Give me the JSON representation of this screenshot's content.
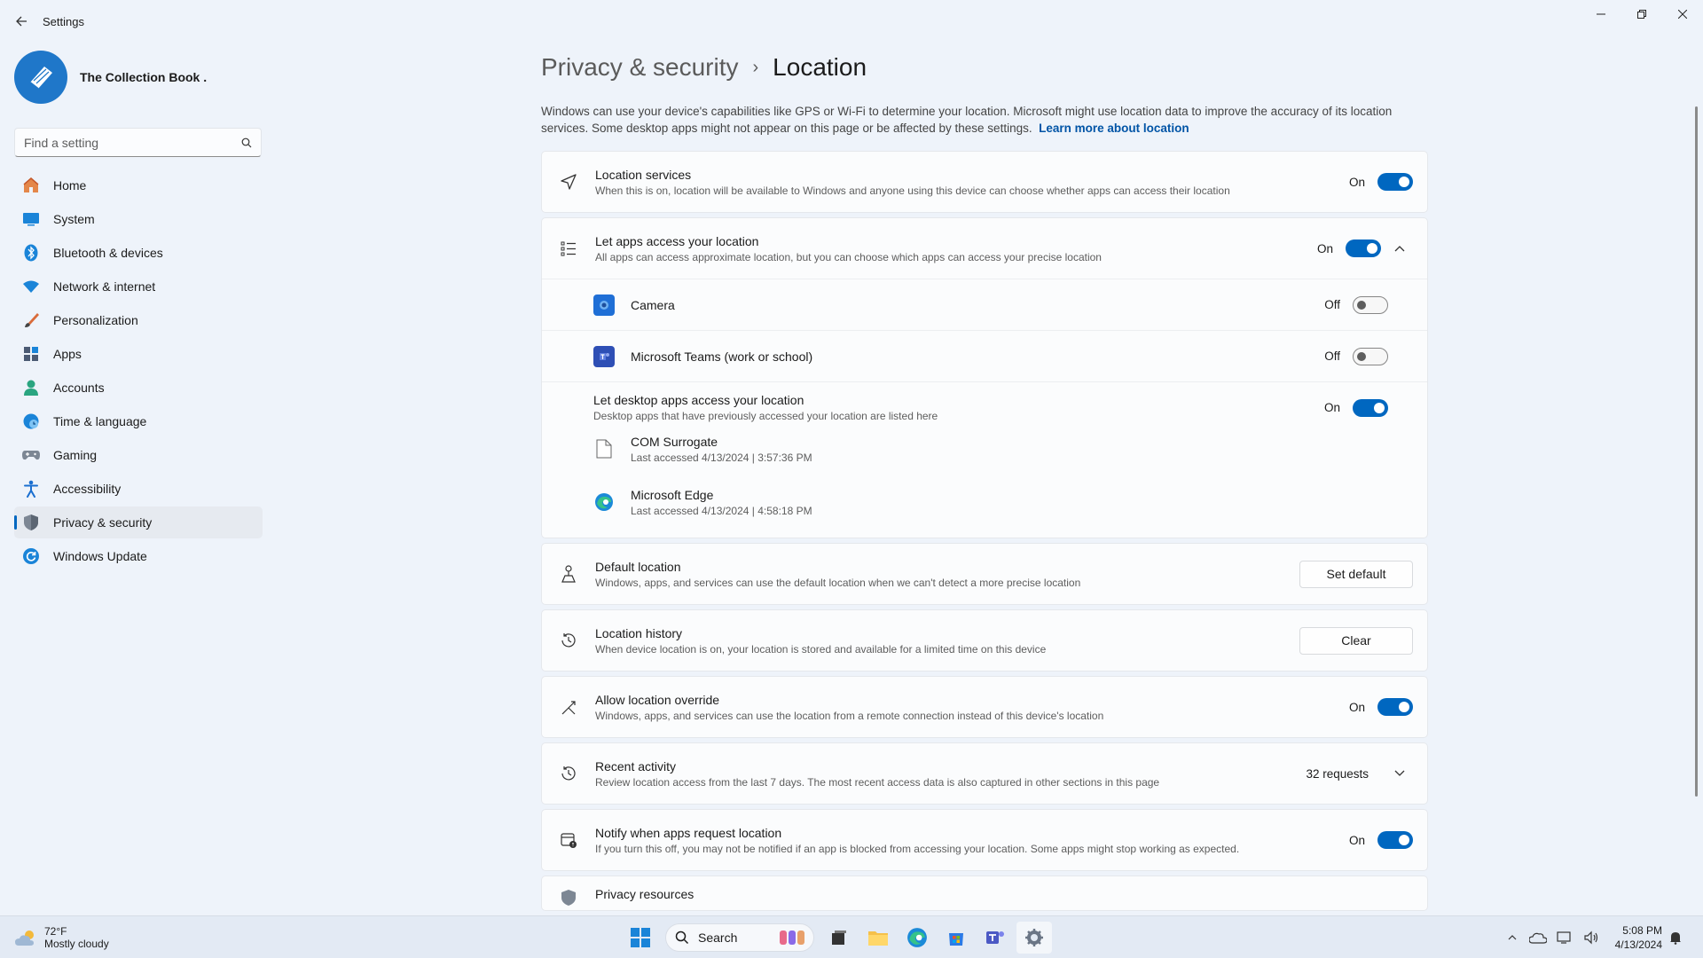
{
  "window": {
    "app_title": "Settings"
  },
  "profile": {
    "name": "The Collection Book ."
  },
  "search": {
    "placeholder": "Find a setting"
  },
  "sidebar": {
    "items": [
      {
        "label": "Home",
        "icon": "home-icon"
      },
      {
        "label": "System",
        "icon": "system-icon"
      },
      {
        "label": "Bluetooth & devices",
        "icon": "bluetooth-icon"
      },
      {
        "label": "Network & internet",
        "icon": "wifi-icon"
      },
      {
        "label": "Personalization",
        "icon": "brush-icon"
      },
      {
        "label": "Apps",
        "icon": "apps-icon"
      },
      {
        "label": "Accounts",
        "icon": "person-icon"
      },
      {
        "label": "Time & language",
        "icon": "globe-clock-icon"
      },
      {
        "label": "Gaming",
        "icon": "gamepad-icon"
      },
      {
        "label": "Accessibility",
        "icon": "accessibility-icon"
      },
      {
        "label": "Privacy & security",
        "icon": "shield-icon",
        "active": true
      },
      {
        "label": "Windows Update",
        "icon": "update-icon"
      }
    ]
  },
  "header": {
    "parent": "Privacy & security",
    "separator": "›",
    "current": "Location"
  },
  "intro": {
    "text": "Windows can use your device's capabilities like GPS or Wi-Fi to determine your location. Microsoft might use location data to improve the accuracy of its location services. Some desktop apps might not appear on this page or be affected by these settings.",
    "link": "Learn more about location"
  },
  "location_services": {
    "title": "Location services",
    "sub": "When this is on, location will be available to Windows and anyone using this device can choose whether apps can access their location",
    "state": "On"
  },
  "app_access": {
    "title": "Let apps access your location",
    "sub": "All apps can access approximate location, but you can choose which apps can access your precise location",
    "state": "On",
    "apps": [
      {
        "name": "Camera",
        "state": "Off"
      },
      {
        "name": "Microsoft Teams (work or school)",
        "state": "Off"
      }
    ],
    "desktop": {
      "title": "Let desktop apps access your location",
      "sub": "Desktop apps that have previously accessed your location are listed here",
      "state": "On",
      "apps": [
        {
          "name": "COM Surrogate",
          "accessed": "Last accessed 4/13/2024  |  3:57:36 PM"
        },
        {
          "name": "Microsoft Edge",
          "accessed": "Last accessed 4/13/2024  |  4:58:18 PM"
        }
      ]
    }
  },
  "default_location": {
    "title": "Default location",
    "sub": "Windows, apps, and services can use the default location when we can't detect a more precise location",
    "button": "Set default"
  },
  "location_history": {
    "title": "Location history",
    "sub": "When device location is on, your location is stored and available for a limited time on this device",
    "button": "Clear"
  },
  "override": {
    "title": "Allow location override",
    "sub": "Windows, apps, and services can use the location from a remote connection instead of this device's location",
    "state": "On"
  },
  "recent": {
    "title": "Recent activity",
    "sub": "Review location access from the last 7 days. The most recent access data is also captured in other sections in this page",
    "count": "32 requests"
  },
  "notify": {
    "title": "Notify when apps request location",
    "sub": "If you turn this off, you may not be notified if an app is blocked from accessing your location. Some apps might stop working as expected.",
    "state": "On"
  },
  "privacy_resources": {
    "title": "Privacy resources"
  },
  "taskbar": {
    "weather_temp": "72°F",
    "weather_desc": "Mostly cloudy",
    "search_label": "Search",
    "time": "5:08 PM",
    "date": "4/13/2024"
  },
  "colors": {
    "accent": "#0067c0",
    "background": "#eef3fa"
  }
}
